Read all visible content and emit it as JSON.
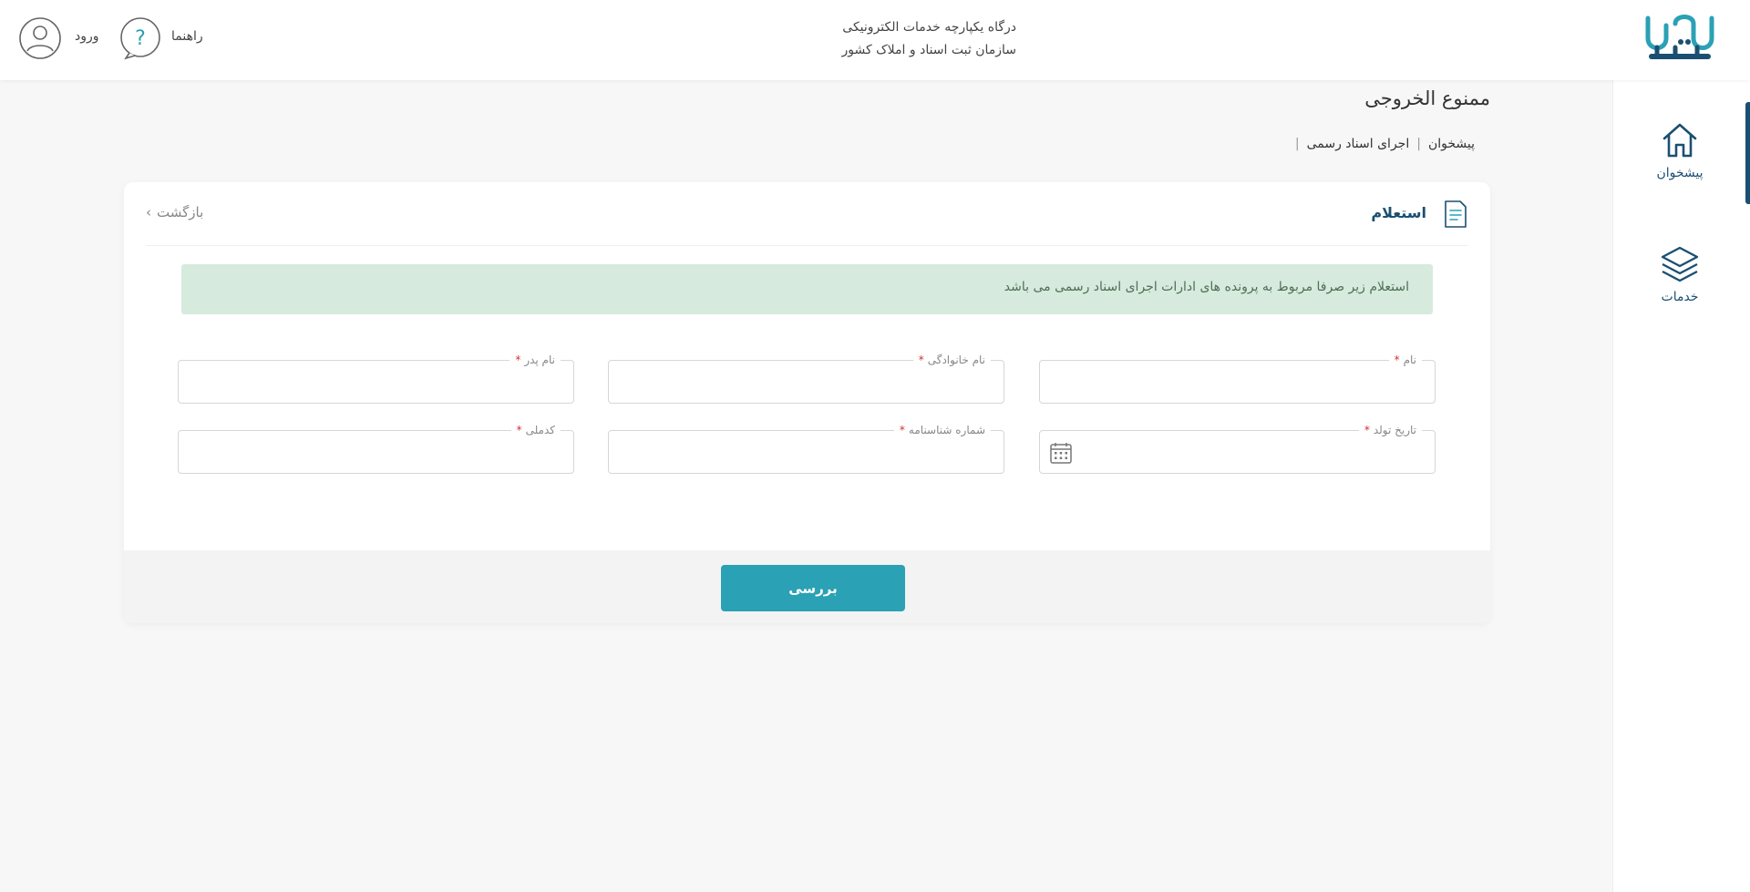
{
  "header": {
    "title_line1": "درگاه یکپارچه خدمات الکترونیکی",
    "title_line2": "سازمان ثبت اسناد و املاک کشور",
    "login_label": "ورود",
    "help_label": "راهنما",
    "logo_text": "ثبت من"
  },
  "sidebar": {
    "items": [
      {
        "label": "پیشخوان",
        "icon": "home-icon",
        "active": true
      },
      {
        "label": "خدمات",
        "icon": "layers-icon",
        "active": false
      }
    ]
  },
  "page": {
    "title": "ممنوع الخروجی",
    "breadcrumb": [
      "پیشخوان",
      "اجرای اسناد رسمی"
    ]
  },
  "card": {
    "title": "استعلام",
    "back_label": "بازگشت",
    "notice": "استعلام زیر صرفا مربوط به پرونده های ادارات اجرای اسناد رسمی می باشد",
    "fields": {
      "first_name": {
        "label": "نام",
        "value": ""
      },
      "last_name": {
        "label": "نام خانوادگی",
        "value": ""
      },
      "father_name": {
        "label": "نام پدر",
        "value": ""
      },
      "birth_date": {
        "label": "تاریخ تولد",
        "value": ""
      },
      "id_number": {
        "label": "شماره شناسنامه",
        "value": ""
      },
      "national_code": {
        "label": "کدملی",
        "value": ""
      }
    },
    "submit_label": "بررسی"
  },
  "colors": {
    "primary": "#1b4f72",
    "accent": "#2aa1b5",
    "notice_bg": "#d6eadd",
    "required": "#d32f2f"
  }
}
